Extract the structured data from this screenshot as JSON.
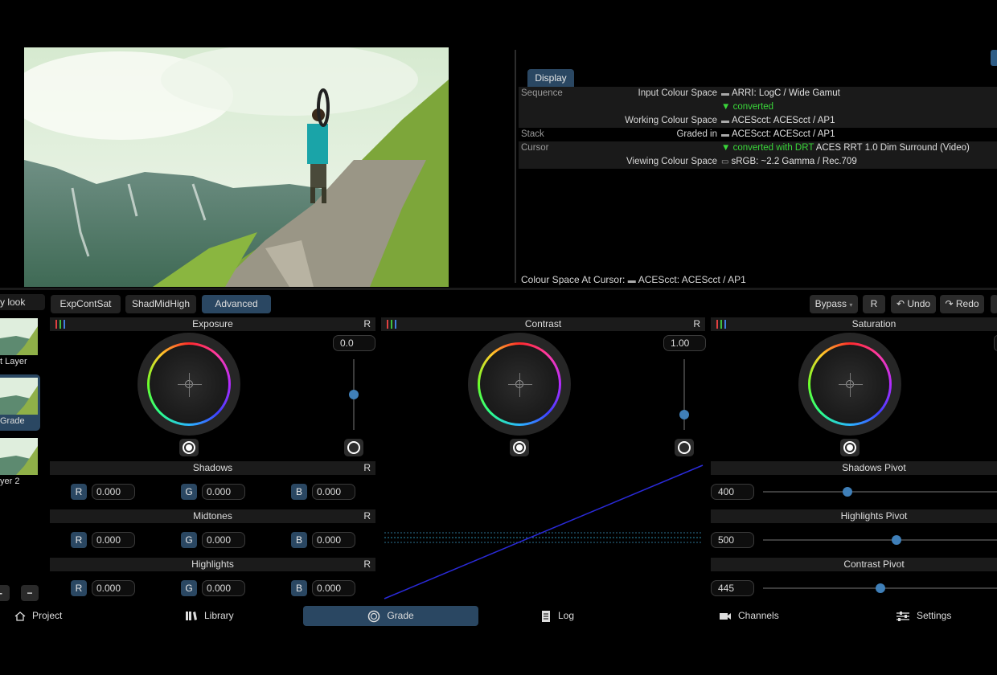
{
  "info_panel": {
    "tab": "Display",
    "rows": [
      {
        "label": "Sequence",
        "key": "Input Colour Space",
        "value": "ARRI: LogC / Wide Gamut",
        "icon": "camera-icon"
      },
      {
        "label": "",
        "key": "",
        "value": "▼ converted",
        "green": true
      },
      {
        "label": "",
        "key": "Working Colour Space",
        "value": "ACEScct: ACEScct / AP1",
        "icon": "camera-icon"
      },
      {
        "label": "Stack",
        "key": "Graded in",
        "value": "ACEScct: ACEScct / AP1",
        "icon": "camera-icon"
      },
      {
        "label": "Cursor",
        "key": "",
        "value_green": "▼ converted with DRT",
        "value": "ACES RRT 1.0 Dim Surround (Video)"
      },
      {
        "label": "",
        "key": "Viewing Colour Space",
        "value": "sRGB: ~2.2 Gamma / Rec.709",
        "icon": "monitor-icon"
      }
    ],
    "cursor_cs_label": "Colour Space At Cursor:",
    "cursor_cs_value": "ACEScct: ACEScct / AP1"
  },
  "layers": {
    "look_label": "y look",
    "items": [
      {
        "name": "t Layer"
      },
      {
        "name": "Grade",
        "selected": true
      },
      {
        "name": "yer 2"
      }
    ],
    "add_label": "-",
    "remove_label": "−"
  },
  "grade_tabs": [
    "ExpContSat",
    "ShadMidHigh",
    "Advanced"
  ],
  "active_tab": "Advanced",
  "toolbar": {
    "bypass": "Bypass",
    "reset": "R",
    "undo": "Undo",
    "redo": "Redo"
  },
  "panels": {
    "exposure": {
      "title": "Exposure",
      "reset": "R",
      "value": "0.0",
      "slider_fraction": 0.5
    },
    "contrast": {
      "title": "Contrast",
      "reset": "R",
      "value": "1.00",
      "slider_fraction": 0.78
    },
    "saturation": {
      "title": "Saturation"
    }
  },
  "rgb_groups": [
    {
      "title": "Shadows",
      "reset": "R",
      "r": "0.000",
      "g": "0.000",
      "b": "0.000"
    },
    {
      "title": "Midtones",
      "reset": "R",
      "r": "0.000",
      "g": "0.000",
      "b": "0.000"
    },
    {
      "title": "Highlights",
      "reset": "R",
      "r": "0.000",
      "g": "0.000",
      "b": "0.000"
    }
  ],
  "channel_labels": {
    "r": "R",
    "g": "G",
    "b": "B"
  },
  "pivots": [
    {
      "title": "Shadows Pivot",
      "value": "400",
      "fraction": 0.36
    },
    {
      "title": "Highlights Pivot",
      "value": "500",
      "fraction": 0.57
    },
    {
      "title": "Contrast Pivot",
      "value": "445",
      "fraction": 0.5
    }
  ],
  "nav": [
    {
      "label": "Project",
      "icon": "home-icon"
    },
    {
      "label": "Library",
      "icon": "library-icon"
    },
    {
      "label": "Grade",
      "icon": "grade-icon",
      "active": true
    },
    {
      "label": "Log",
      "icon": "log-icon"
    },
    {
      "label": "Channels",
      "icon": "camera-icon"
    },
    {
      "label": "Settings",
      "icon": "sliders-icon"
    }
  ],
  "colors": {
    "accent": "#2a4762",
    "green": "#3ad63a",
    "knob": "#3f7fb8"
  }
}
